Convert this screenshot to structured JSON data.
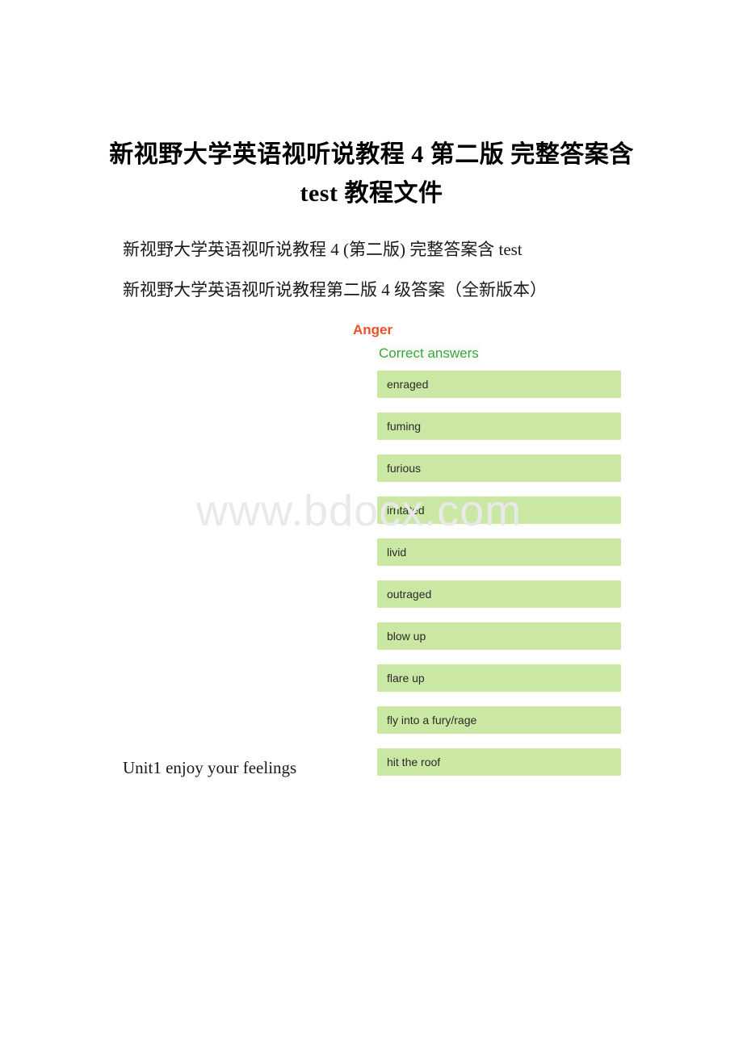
{
  "document": {
    "title": "新视野大学英语视听说教程 4 第二版 完整答案含 test 教程文件",
    "body_lines": [
      "新视野大学英语视听说教程 4 (第二版) 完整答案含 test",
      "新视野大学英语视听说教程第二版 4 级答案（全新版本）"
    ],
    "bottom_line": "Unit1 enjoy your feelings",
    "watermark": "www.bdocx.com"
  },
  "quiz": {
    "heading": "Anger",
    "subheading": "Correct answers",
    "heading_color": "#f04f26",
    "subheading_color": "#3aa53a",
    "answer_box_color": "#cbe7a4",
    "answers": [
      {
        "label": "enraged"
      },
      {
        "label": "fuming"
      },
      {
        "label": "furious"
      },
      {
        "label": "irritated"
      },
      {
        "label": "livid"
      },
      {
        "label": "outraged"
      },
      {
        "label": "blow up"
      },
      {
        "label": "flare up"
      },
      {
        "label": "fly into a fury/rage"
      },
      {
        "label": "hit the roof"
      }
    ]
  }
}
